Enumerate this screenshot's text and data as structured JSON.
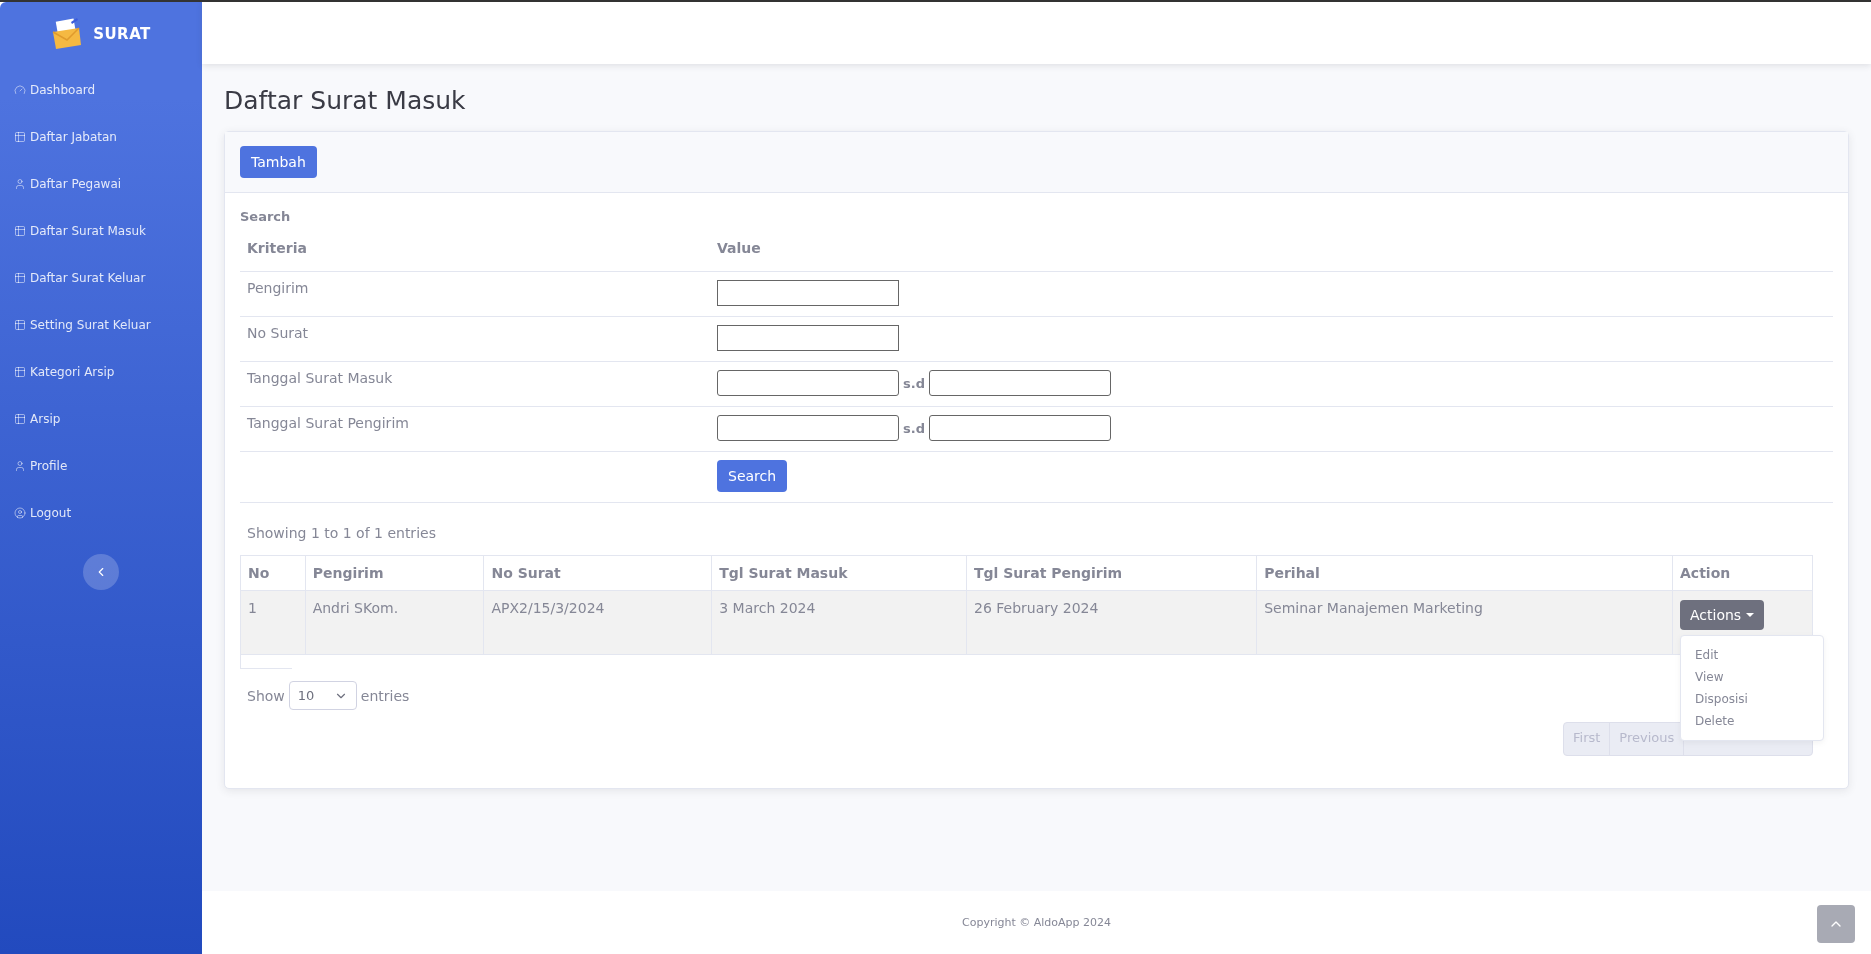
{
  "brand": {
    "title": "SURAT"
  },
  "sidebar": {
    "items": [
      {
        "label": "Dashboard",
        "kind": "gauge",
        "selected": false
      },
      {
        "label": "Daftar Jabatan",
        "kind": "table",
        "selected": false
      },
      {
        "label": "Daftar Pegawai",
        "kind": "user",
        "selected": false
      },
      {
        "label": "Daftar Surat Masuk",
        "kind": "table",
        "selected": false
      },
      {
        "label": "Daftar Surat Keluar",
        "kind": "table",
        "selected": false
      },
      {
        "label": "Setting Surat Keluar",
        "kind": "table",
        "selected": false
      },
      {
        "label": "Kategori Arsip",
        "kind": "table",
        "selected": false
      },
      {
        "label": "Arsip",
        "kind": "table",
        "selected": false
      },
      {
        "label": "Profile",
        "kind": "user",
        "selected": false
      },
      {
        "label": "Logout",
        "kind": "logout",
        "selected": false
      }
    ]
  },
  "page_title": "Daftar Surat Masuk",
  "add_button": "Tambah",
  "search": {
    "heading": "Search",
    "columns": [
      "Kriteria",
      "Value"
    ],
    "rows": [
      {
        "label": "Pengirim",
        "kind": "single"
      },
      {
        "label": "No Surat",
        "kind": "single"
      },
      {
        "label": "Tanggal Surat Masuk",
        "kind": "range",
        "separator": "s.d"
      },
      {
        "label": "Tanggal Surat Pengirim",
        "kind": "range",
        "separator": "s.d"
      }
    ],
    "button": "Search"
  },
  "info": "Showing 1 to 1 of 1 entries",
  "table": {
    "columns": [
      "No",
      "Pengirim",
      "No Surat",
      "Tgl Surat Masuk",
      "Tgl Surat Pengirim",
      "Perihal",
      "Action"
    ],
    "rows": [
      {
        "cells": [
          "1",
          "Andri SKom.",
          "APX2/15/3/2024",
          "3 March 2024",
          "26 February 2024",
          "Seminar Manajemen Marketing"
        ],
        "action": "Actions",
        "menu_open": true
      }
    ]
  },
  "actions_menu": [
    "Edit",
    "View",
    "Disposisi",
    "Delete"
  ],
  "length": {
    "label_before": "Show",
    "value": "10",
    "label_after": "entries"
  },
  "pagination": [
    "First",
    "Previous"
  ],
  "footer": "Copyright © AldoApp 2024"
}
